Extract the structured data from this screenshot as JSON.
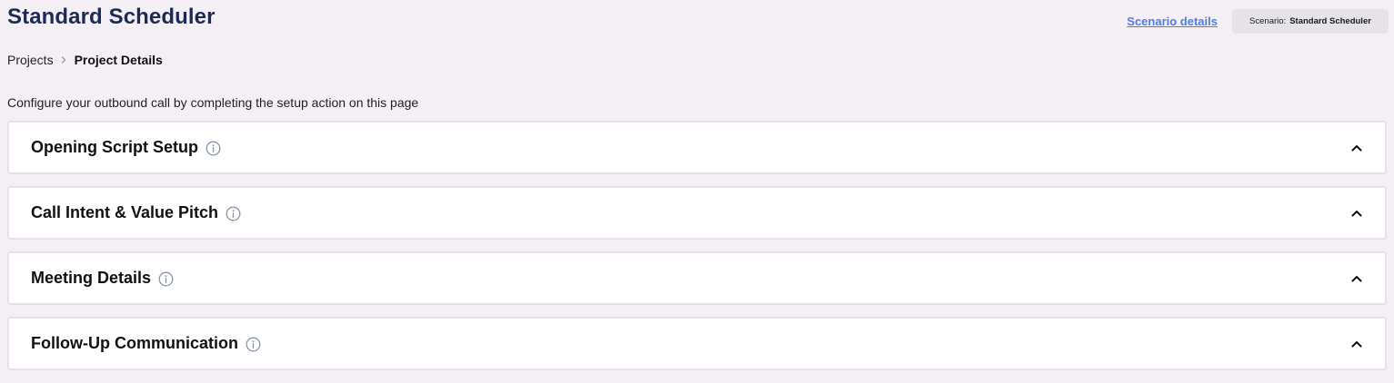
{
  "header": {
    "title": "Standard Scheduler",
    "scenario_link": "Scenario details",
    "scenario_badge": {
      "prefix": "Scenario:",
      "value": "Standard Scheduler"
    }
  },
  "breadcrumb": {
    "items": [
      "Projects",
      "Project Details"
    ]
  },
  "instructions": "Configure your outbound call by completing the setup action on this page",
  "sections": [
    {
      "title": "Opening Script Setup",
      "expanded": true
    },
    {
      "title": "Call Intent & Value Pitch",
      "expanded": true
    },
    {
      "title": "Meeting Details",
      "expanded": true
    },
    {
      "title": "Follow-Up Communication",
      "expanded": true
    }
  ],
  "icons": {
    "info": "info-circle-icon",
    "chevron": "chevron-up-icon",
    "breadcrumb_separator": "chevron-right-icon"
  },
  "colors": {
    "background": "#f3eff5",
    "title": "#1c2a55",
    "link": "#4f7ee6",
    "badge_bg": "#e5e3e7",
    "card_border": "#e6e1e8",
    "info_icon": "#8a93a8"
  }
}
